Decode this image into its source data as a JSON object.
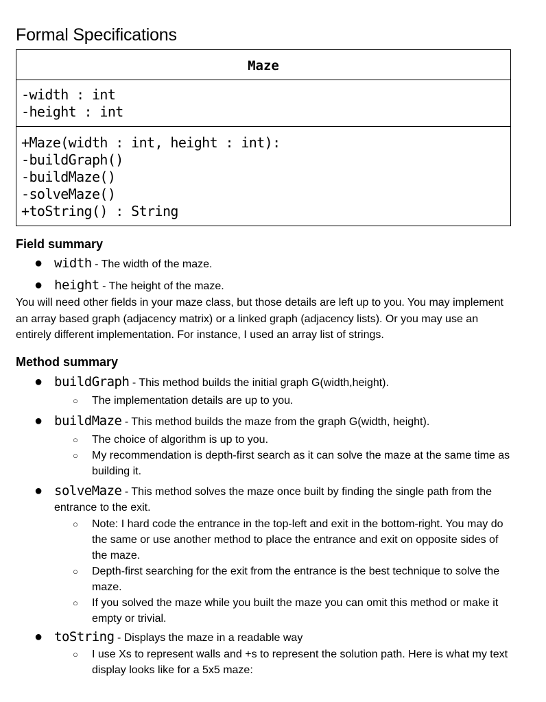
{
  "page_title": "Formal Specifications",
  "uml": {
    "class_name": "Maze",
    "fields": [
      "-width : int",
      "-height : int"
    ],
    "methods": [
      "+Maze(width : int, height : int):",
      "-buildGraph()",
      "-buildMaze()",
      "-solveMaze()",
      "+toString() : String"
    ]
  },
  "field_summary": {
    "heading": "Field summary",
    "items": [
      {
        "name": "width",
        "desc": " - The width of the maze."
      },
      {
        "name": "height",
        "desc": " - The height of the maze."
      }
    ],
    "paragraph": "You will need other fields in your maze class, but those details are left up to you. You may implement an array based graph (adjacency matrix) or a linked graph (adjacency lists). Or you may use an entirely different implementation. For instance, I used an array list of strings."
  },
  "method_summary": {
    "heading": "Method summary",
    "items": [
      {
        "name": "buildGraph",
        "desc": " - This method builds the initial graph G(width,height).",
        "sub": [
          "The implementation details are up to you."
        ]
      },
      {
        "name": "buildMaze",
        "desc": " - This method builds the maze from the graph G(width, height).",
        "sub": [
          "The choice of algorithm is up to you.",
          "My recommendation is depth-first search as it can solve the maze at the same time as building it."
        ]
      },
      {
        "name": "solveMaze",
        "desc": " - This method solves the maze once built by finding the single path from the entrance to the exit.",
        "sub": [
          "Note: I hard code the entrance in the top-left and exit in the bottom-right. You may do the same or use another method to place the entrance and exit on opposite sides of the maze.",
          "Depth-first searching for the exit from the entrance is the best technique to solve the maze.",
          "If you solved the maze while you built the maze you can omit this method or make it empty or trivial."
        ]
      },
      {
        "name": "toString",
        "desc": " - Displays the maze in a readable way",
        "sub": [
          "I use Xs to represent walls and +s to represent the solution path.  Here is what my text display looks like for a 5x5 maze:"
        ]
      }
    ]
  },
  "icons": {
    "bullet": "●",
    "sub_bullet": "○"
  }
}
